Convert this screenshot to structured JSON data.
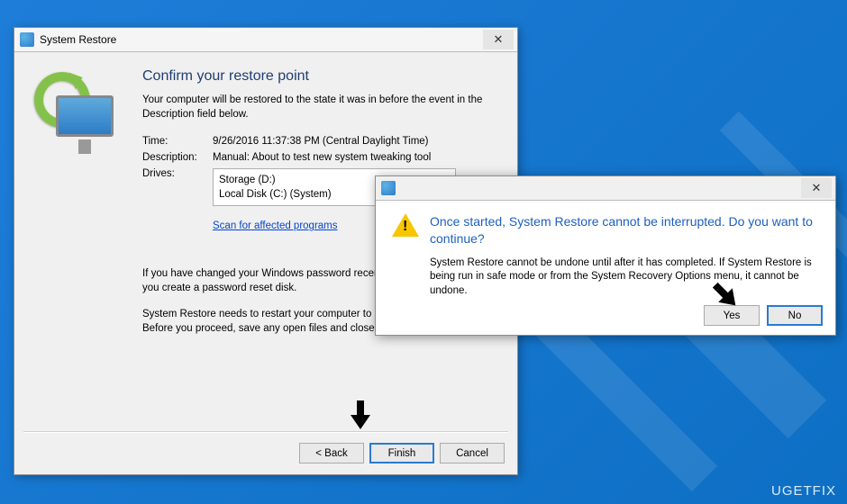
{
  "main": {
    "title": "System Restore",
    "heading": "Confirm your restore point",
    "subtext": "Your computer will be restored to the state it was in before the event in the Description field below.",
    "labels": {
      "time": "Time:",
      "description": "Description:",
      "drives": "Drives:"
    },
    "values": {
      "time": "9/26/2016 11:37:38 PM (Central Daylight Time)",
      "description": "Manual: About to test new system tweaking tool",
      "drive1": "Storage (D:)",
      "drive2": "Local Disk (C:) (System)"
    },
    "scan_link": "Scan for affected programs",
    "note_password": "If you have changed your Windows password recently, we recommend that you create a password reset disk.",
    "note_restart": "System Restore needs to restart your computer to apply these changes. Before you proceed, save any open files and close all programs.",
    "buttons": {
      "back": "< Back",
      "finish": "Finish",
      "cancel": "Cancel"
    }
  },
  "confirm": {
    "heading": "Once started, System Restore cannot be interrupted. Do you want to continue?",
    "text": "System Restore cannot be undone until after it has completed. If System Restore is being run in safe mode or from the System Recovery Options menu, it cannot be undone.",
    "buttons": {
      "yes": "Yes",
      "no": "No"
    }
  },
  "watermark": "UGETFIX"
}
